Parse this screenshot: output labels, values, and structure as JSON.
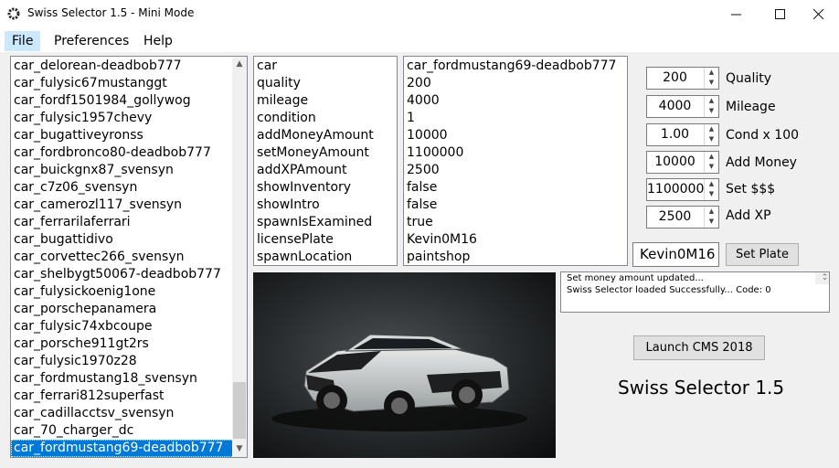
{
  "window": {
    "title": "Swiss Selector 1.5 - Mini Mode"
  },
  "menu": [
    "File",
    "Preferences",
    "Help"
  ],
  "car_list": [
    "car_delorean-deadbob777",
    "car_fulysic67mustanggt",
    "car_fordf1501984_gollywog",
    "car_fulysic1957chevy",
    "car_bugattiveyronss",
    "car_fordbronco80-deadbob777",
    "car_buickgnx87_svensyn",
    "car_c7z06_svensyn",
    "car_camerozl117_svensyn",
    "car_ferrarilaferrari",
    "car_bugattidivo",
    "car_corvettec266_svensyn",
    "car_shelbygt50067-deadbob777",
    "car_fulysickoenig1one",
    "car_porschepanamera",
    "car_fulysic74xbcoupe",
    "car_porsche911gt2rs",
    "car_fulysic1970z28",
    "car_fordmustang18_svensyn",
    "car_ferrari812superfast",
    "car_cadillacctsv_svensyn",
    "car_70_charger_dc",
    "car_fordmustang69-deadbob777"
  ],
  "properties": {
    "keys": [
      "car",
      "quality",
      "mileage",
      "condition",
      "addMoneyAmount",
      "setMoneyAmount",
      "addXPAmount",
      "showInventory",
      "showIntro",
      "spawnIsExamined",
      "licensePlate",
      "spawnLocation"
    ],
    "values": [
      "car_fordmustang69-deadbob777",
      "200",
      "4000",
      "1",
      "10000",
      "1100000",
      "2500",
      "false",
      "false",
      "true",
      "Kevin0M16",
      "paintshop"
    ]
  },
  "controls": {
    "quality": {
      "value": "200",
      "label": "Quality"
    },
    "mileage": {
      "value": "4000",
      "label": "Mileage"
    },
    "condition": {
      "value": "1.00",
      "label": "Cond x 100"
    },
    "add_money": {
      "value": "10000",
      "label": "Add Money"
    },
    "set_money": {
      "value": "1100000",
      "label": "Set $$$"
    },
    "add_xp": {
      "value": "2500",
      "label": "Add XP"
    },
    "plate": {
      "value": "Kevin0M16",
      "button": "Set Plate"
    }
  },
  "status_log": [
    "Set money amount updated...",
    "Swiss Selector loaded Successfully... Code: 0"
  ],
  "launch_button": "Launch CMS 2018",
  "app_title": "Swiss Selector 1.5"
}
